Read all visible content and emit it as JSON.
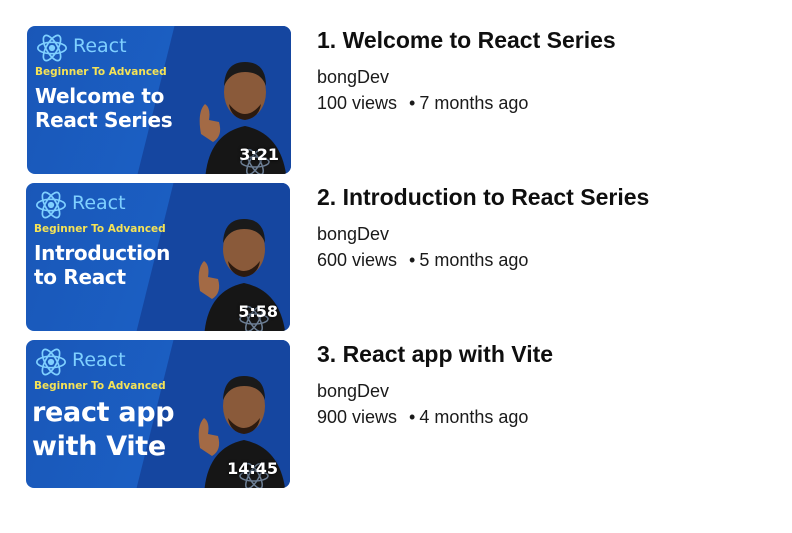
{
  "videos": [
    {
      "title": "1. Welcome to React Series",
      "channel": "bongDev",
      "views": "100 views",
      "age": "7 months ago",
      "duration": "3:21",
      "thumb": {
        "logo_text": "React",
        "tag": "Beginner To Advanced",
        "headline_lines": [
          "Welcome to",
          "React Series"
        ],
        "logo_icon": "react-atom-icon"
      }
    },
    {
      "title": "2. Introduction to React Series",
      "channel": "bongDev",
      "views": "600 views",
      "age": "5 months ago",
      "duration": "5:58",
      "thumb": {
        "logo_text": "React",
        "tag": "Beginner To Advanced",
        "headline_lines": [
          "Introduction",
          "to React"
        ],
        "logo_icon": "react-atom-icon"
      }
    },
    {
      "title": "3. React app with Vite",
      "channel": "bongDev",
      "views": "900 views",
      "age": "4 months ago",
      "duration": "14:45",
      "thumb": {
        "logo_text": "React",
        "tag": "Beginner To Advanced",
        "headline_lines": [
          "react app",
          "with Vite"
        ],
        "logo_icon": "react-atom-icon"
      }
    }
  ],
  "separator": "•",
  "colors": {
    "thumb_blue": "#1b5fc3",
    "react_cyan": "#7fd0ff",
    "tag_yellow": "#f5e356"
  }
}
